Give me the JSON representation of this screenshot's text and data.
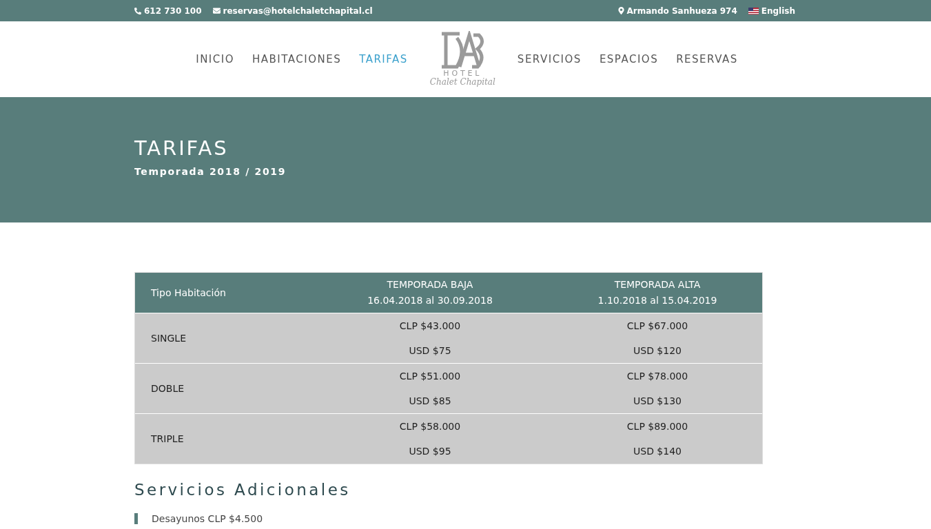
{
  "top_bar": {
    "phone": "612 730 100",
    "email": "reservas@hotelchaletchapital.cl",
    "address": "Armando Sanhueza 974",
    "language": "English"
  },
  "nav": {
    "left": [
      {
        "label": "INICIO",
        "selected": false
      },
      {
        "label": "HABITACIONES",
        "selected": false
      },
      {
        "label": "TARIFAS",
        "selected": true
      }
    ],
    "logo": {
      "line_1": "HOTEL",
      "line_2": "Chalet Chapital"
    },
    "right": [
      {
        "label": "SERVICIOS",
        "selected": false
      },
      {
        "label": "ESPACIOS",
        "selected": false
      },
      {
        "label": "RESERVAS",
        "selected": false
      }
    ]
  },
  "hero": {
    "title": "TARIFAS",
    "subtitle": "Temporada 2018 / 2019"
  },
  "table": {
    "columns": [
      {
        "title": "Tipo Habitación"
      },
      {
        "title": "TEMPORADA BAJA",
        "dates": "16.04.2018 al 30.09.2018"
      },
      {
        "title": "TEMPORADA ALTA",
        "dates": "1.10.2018 al 15.04.2019"
      }
    ],
    "rows": [
      {
        "room": "SINGLE",
        "low": [
          "CLP $43.000",
          "USD $75"
        ],
        "high": [
          "CLP $67.000",
          "USD $120"
        ]
      },
      {
        "room": "DOBLE",
        "low": [
          "CLP $51.000",
          "USD $85"
        ],
        "high": [
          "CLP $78.000",
          "USD $130"
        ]
      },
      {
        "room": "TRIPLE",
        "low": [
          "CLP $58.000",
          "USD $95"
        ],
        "high": [
          "CLP $89.000",
          "USD $140"
        ]
      }
    ]
  },
  "extras": {
    "heading": "Servicios Adicionales",
    "items": [
      "Desayunos CLP $4.500"
    ]
  }
}
